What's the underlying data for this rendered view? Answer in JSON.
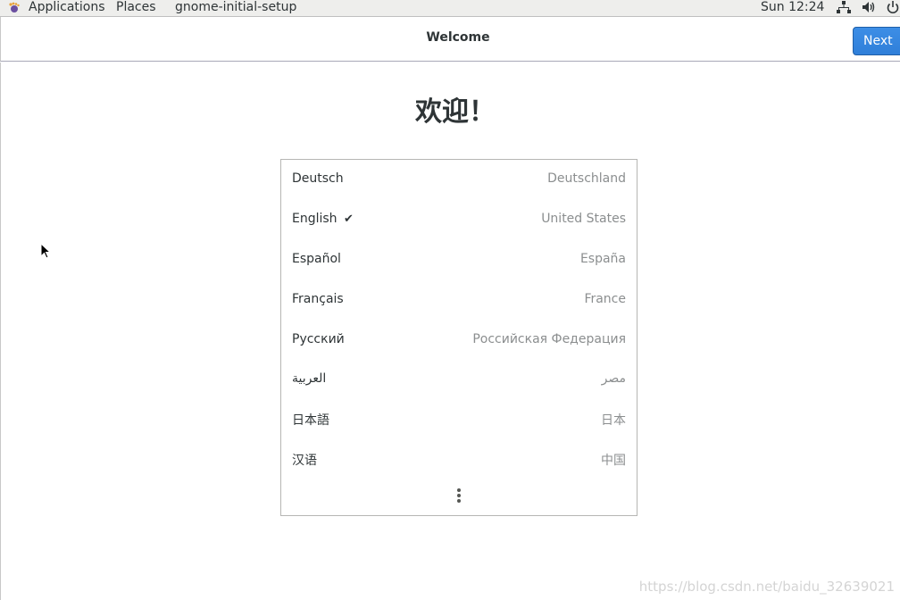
{
  "topbar": {
    "applications": "Applications",
    "places": "Places",
    "app_name": "gnome-initial-setup",
    "clock": "Sun 12:24"
  },
  "header": {
    "title": "Welcome",
    "next_label": "Next"
  },
  "main": {
    "welcome_text": "欢迎！",
    "languages": [
      {
        "name": "Deutsch",
        "region": "Deutschland",
        "selected": false
      },
      {
        "name": "English",
        "region": "United States",
        "selected": true
      },
      {
        "name": "Español",
        "region": "España",
        "selected": false
      },
      {
        "name": "Français",
        "region": "France",
        "selected": false
      },
      {
        "name": "Русский",
        "region": "Российская Федерация",
        "selected": false
      },
      {
        "name": "العربية",
        "region": "مصر",
        "selected": false
      },
      {
        "name": "日本語",
        "region": "日本",
        "selected": false
      },
      {
        "name": "汉语",
        "region": "中国",
        "selected": false
      }
    ],
    "check_mark": "✔"
  },
  "watermark": "https://blog.csdn.net/baidu_32639021",
  "colors": {
    "accent": "#2f7fd9",
    "topbar_bg": "#eeeeec",
    "region_text": "#8b8e8f"
  }
}
